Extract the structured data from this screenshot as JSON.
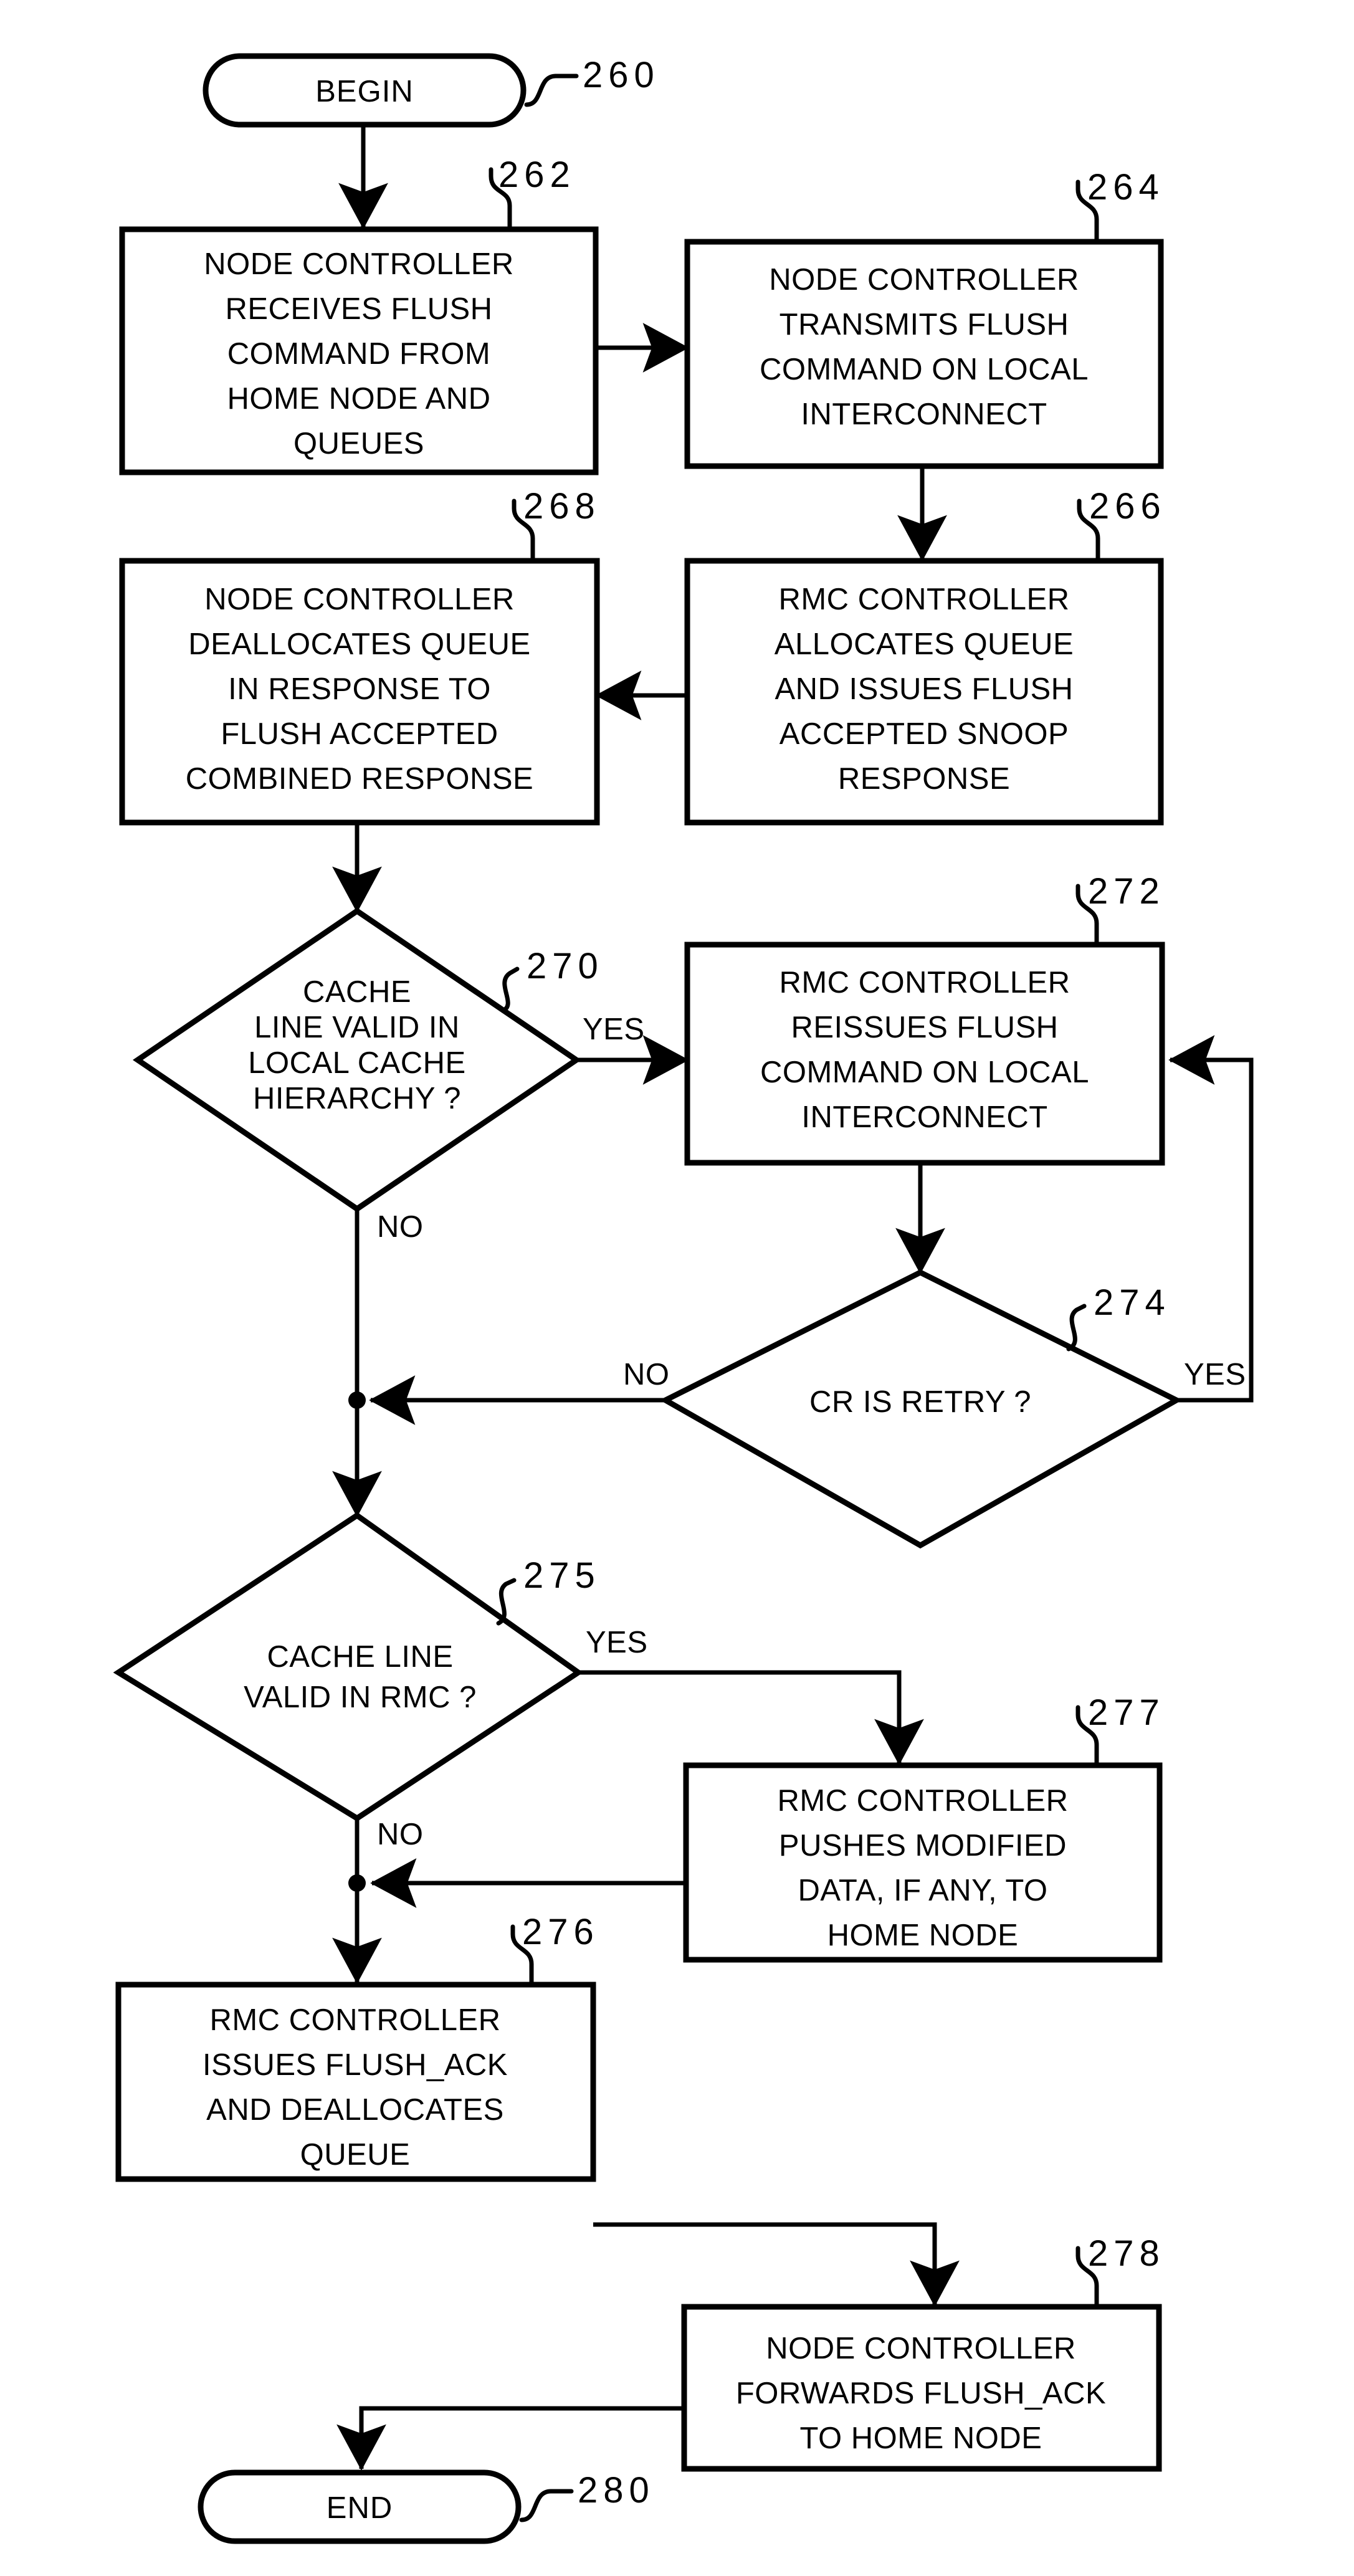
{
  "figure": {
    "type": "flowchart",
    "title": "",
    "nodes": [
      {
        "id": "260",
        "kind": "terminator",
        "ref": "260",
        "lines": [
          "BEGIN"
        ]
      },
      {
        "id": "262",
        "kind": "process",
        "ref": "262",
        "lines": [
          "NODE CONTROLLER",
          "RECEIVES FLUSH",
          "COMMAND FROM",
          "HOME NODE AND",
          "QUEUES"
        ]
      },
      {
        "id": "264",
        "kind": "process",
        "ref": "264",
        "lines": [
          "NODE CONTROLLER",
          "TRANSMITS FLUSH",
          "COMMAND ON LOCAL",
          "INTERCONNECT"
        ]
      },
      {
        "id": "266",
        "kind": "process",
        "ref": "266",
        "lines": [
          "RMC CONTROLLER",
          "ALLOCATES QUEUE",
          "AND ISSUES FLUSH",
          "ACCEPTED SNOOP",
          "RESPONSE"
        ]
      },
      {
        "id": "268",
        "kind": "process",
        "ref": "268",
        "lines": [
          "NODE CONTROLLER",
          "DEALLOCATES QUEUE",
          "IN RESPONSE TO",
          "FLUSH ACCEPTED",
          "COMBINED RESPONSE"
        ]
      },
      {
        "id": "270",
        "kind": "decision",
        "ref": "270",
        "lines": [
          "CACHE",
          "LINE VALID IN",
          "LOCAL CACHE",
          "HIERARCHY ?"
        ]
      },
      {
        "id": "272",
        "kind": "process",
        "ref": "272",
        "lines": [
          "RMC CONTROLLER",
          "REISSUES FLUSH",
          "COMMAND ON LOCAL",
          "INTERCONNECT"
        ]
      },
      {
        "id": "274",
        "kind": "decision",
        "ref": "274",
        "lines": [
          "CR IS RETRY ?"
        ]
      },
      {
        "id": "275",
        "kind": "decision",
        "ref": "275",
        "lines": [
          "CACHE LINE",
          "VALID IN RMC ?"
        ]
      },
      {
        "id": "277",
        "kind": "process",
        "ref": "277",
        "lines": [
          "RMC CONTROLLER",
          "PUSHES MODIFIED",
          "DATA, IF ANY, TO",
          "HOME NODE"
        ]
      },
      {
        "id": "276",
        "kind": "process",
        "ref": "276",
        "lines": [
          "RMC CONTROLLER",
          "ISSUES FLUSH_ACK",
          "AND DEALLOCATES",
          "QUEUE"
        ]
      },
      {
        "id": "278",
        "kind": "process",
        "ref": "278",
        "lines": [
          "NODE CONTROLLER",
          "FORWARDS FLUSH_ACK",
          "TO HOME NODE"
        ]
      },
      {
        "id": "280",
        "kind": "terminator",
        "ref": "280",
        "lines": [
          "END"
        ]
      }
    ],
    "branch_labels": {
      "d270_yes": "YES",
      "d270_no": "NO",
      "d274_no": "NO",
      "d274_yes": "YES",
      "d275_yes": "YES",
      "d275_no": "NO"
    },
    "refs": {
      "r260": "260",
      "r262": "262",
      "r264": "264",
      "r266": "266",
      "r268": "268",
      "r270": "270",
      "r272": "272",
      "r274": "274",
      "r275": "275",
      "r276": "276",
      "r277": "277",
      "r278": "278",
      "r280": "280"
    },
    "colors": {
      "line": "#000000",
      "background": "#ffffff",
      "text": "#000000"
    }
  }
}
